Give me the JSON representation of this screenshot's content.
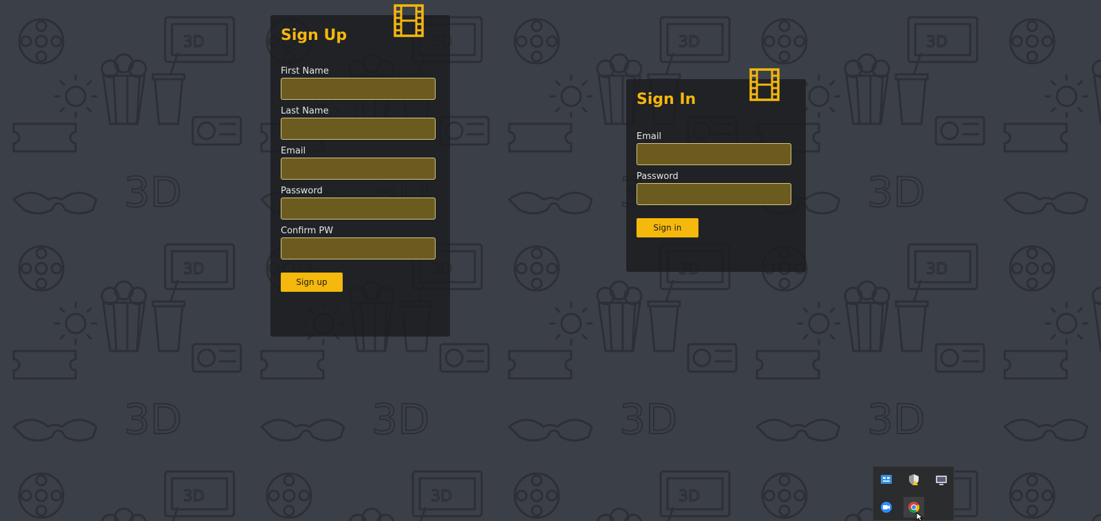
{
  "signup": {
    "title": "Sign Up",
    "fields": [
      {
        "label": "First Name",
        "value": ""
      },
      {
        "label": "Last Name",
        "value": ""
      },
      {
        "label": "Email",
        "value": ""
      },
      {
        "label": "Password",
        "value": ""
      },
      {
        "label": "Confirm PW",
        "value": ""
      }
    ],
    "button_label": "Sign up"
  },
  "signin": {
    "title": "Sign In",
    "fields": [
      {
        "label": "Email",
        "value": ""
      },
      {
        "label": "Password",
        "value": ""
      }
    ],
    "button_label": "Sign in"
  },
  "tray": {
    "icons": [
      "network-monitor-icon",
      "security-shield-icon",
      "display-icon",
      "zoom-icon",
      "chrome-icon"
    ]
  },
  "colors": {
    "accent": "#f5b70d",
    "card_background": "#1c1d1f",
    "input_background": "#6b5b1e",
    "page_background": "#3b3f47"
  }
}
